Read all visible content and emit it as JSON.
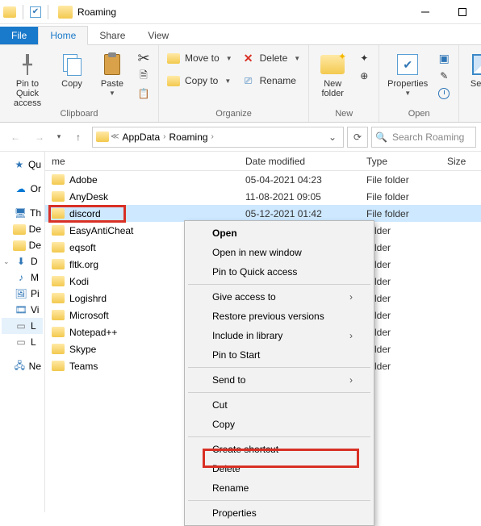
{
  "window": {
    "title": "Roaming"
  },
  "tabs": {
    "file": "File",
    "home": "Home",
    "share": "Share",
    "view": "View"
  },
  "ribbon": {
    "clipboard": {
      "pin": "Pin to Quick access",
      "copy": "Copy",
      "paste": "Paste",
      "group": "Clipboard"
    },
    "organize": {
      "moveto": "Move to",
      "copyto": "Copy to",
      "delete": "Delete",
      "rename": "Rename",
      "group": "Organize"
    },
    "new": {
      "newfolder": "New folder",
      "group": "New"
    },
    "open": {
      "properties": "Properties",
      "group": "Open"
    },
    "select": {
      "select": "Select"
    }
  },
  "breadcrumb": {
    "a": "AppData",
    "b": "Roaming"
  },
  "search": {
    "placeholder": "Search Roaming"
  },
  "columns": {
    "name": "me",
    "date": "Date modified",
    "type": "Type",
    "size": "Size"
  },
  "sidebar": {
    "quick": "Qu",
    "onedrive": "Or",
    "thispc": "Th",
    "desk": "De",
    "docs": "De",
    "down": "D",
    "music": "M",
    "pics": "Pi",
    "vids": "Vi",
    "local": "L",
    "localc": "L",
    "net": "Ne"
  },
  "rows": [
    {
      "name": "Adobe",
      "date": "05-04-2021 04:23",
      "type": "File folder"
    },
    {
      "name": "AnyDesk",
      "date": "11-08-2021 09:05",
      "type": "File folder"
    },
    {
      "name": "discord",
      "date": "05-12-2021 01:42",
      "type": "File folder"
    },
    {
      "name": "EasyAntiCheat",
      "date": "",
      "type": "folder"
    },
    {
      "name": "eqsoft",
      "date": "",
      "type": "folder"
    },
    {
      "name": "fltk.org",
      "date": "",
      "type": "folder"
    },
    {
      "name": "Kodi",
      "date": "",
      "type": "folder"
    },
    {
      "name": "Logishrd",
      "date": "",
      "type": "folder"
    },
    {
      "name": "Microsoft",
      "date": "",
      "type": "folder"
    },
    {
      "name": "Notepad++",
      "date": "",
      "type": "folder"
    },
    {
      "name": "Skype",
      "date": "",
      "type": "folder"
    },
    {
      "name": "Teams",
      "date": "",
      "type": "folder"
    }
  ],
  "ctx": {
    "open": "Open",
    "openwin": "Open in new window",
    "pin": "Pin to Quick access",
    "access": "Give access to",
    "restore": "Restore previous versions",
    "include": "Include in library",
    "pinstart": "Pin to Start",
    "sendto": "Send to",
    "cut": "Cut",
    "copy": "Copy",
    "shortcut": "Create shortcut",
    "delete": "Delete",
    "rename": "Rename",
    "props": "Properties"
  }
}
